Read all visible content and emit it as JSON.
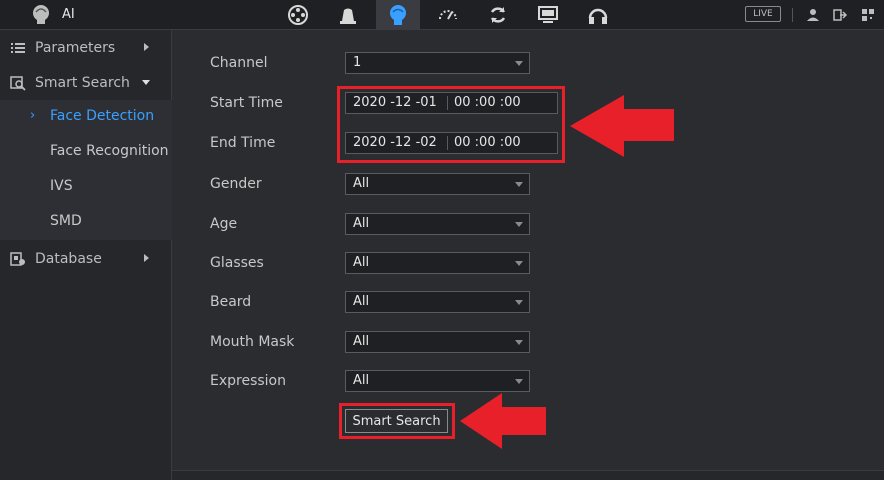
{
  "topbar": {
    "title": "AI",
    "icons": [
      "playback-icon",
      "alarm-icon",
      "ai-icon",
      "dashboard-icon",
      "sync-icon",
      "monitor-icon",
      "headset-icon"
    ],
    "live_label": "LIVE",
    "accent": "#3aa0ff"
  },
  "sidebar": {
    "parameters": "Parameters",
    "smart_search": "Smart Search",
    "sub_items": [
      "Face Detection",
      "Face Recognition",
      "IVS",
      "SMD"
    ],
    "database": "Database"
  },
  "form": {
    "channel_label": "Channel",
    "channel_value": "1",
    "start_label": "Start Time",
    "start_date": "2020 -12 -01",
    "start_time": "00 :00 :00",
    "end_label": "End Time",
    "end_date": "2020 -12 -02",
    "end_time": "00 :00 :00",
    "gender_label": "Gender",
    "gender_value": "All",
    "age_label": "Age",
    "age_value": "All",
    "glasses_label": "Glasses",
    "glasses_value": "All",
    "beard_label": "Beard",
    "beard_value": "All",
    "mask_label": "Mouth Mask",
    "mask_value": "All",
    "expression_label": "Expression",
    "expression_value": "All",
    "search_button": "Smart Search"
  },
  "annotation": {
    "highlight_color": "#e8202a"
  }
}
